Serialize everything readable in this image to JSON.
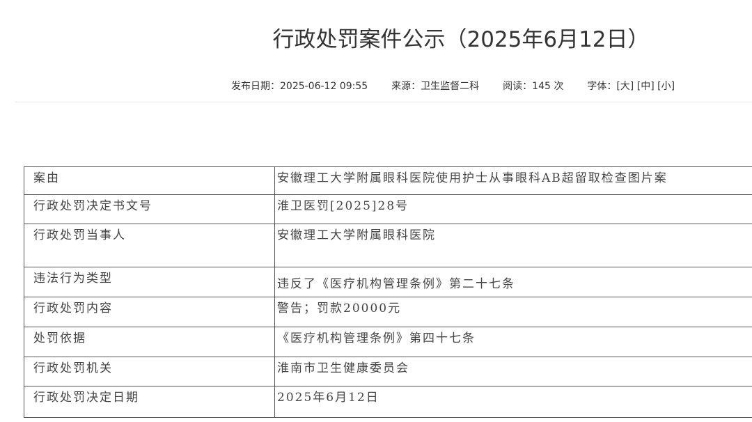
{
  "article": {
    "title": "行政处罚案件公示（2025年6月12日）",
    "meta": {
      "publish_label": "发布日期：",
      "publish_date": "2025-06-12 09:55",
      "source_label": "来源：",
      "source": "卫生监督二科",
      "reads_label": "阅读：",
      "reads": "145 次",
      "font_label": "字体：",
      "font_large": "[大]",
      "font_medium": "[中]",
      "font_small": "[小]"
    }
  },
  "table": {
    "rows": [
      {
        "key": "案由",
        "value": "安徽理工大学附属眼科医院使用护士从事眼科AB超留取检查图片案"
      },
      {
        "key": "行政处罚决定书文号",
        "value": "淮卫医罚[2025]28号"
      },
      {
        "key": "行政处罚当事人",
        "value": "安徽理工大学附属眼科医院"
      },
      {
        "key": "违法行为类型",
        "value": "违反了《医疗机构管理条例》第二十七条"
      },
      {
        "key": "行政处罚内容",
        "value": "警告；罚款20000元"
      },
      {
        "key": "处罚依据",
        "value": "《医疗机构管理条例》第四十七条"
      },
      {
        "key": "行政处罚机关",
        "value": "淮南市卫生健康委员会"
      },
      {
        "key": "行政处罚决定日期",
        "value": "2025年6月12日"
      }
    ]
  }
}
